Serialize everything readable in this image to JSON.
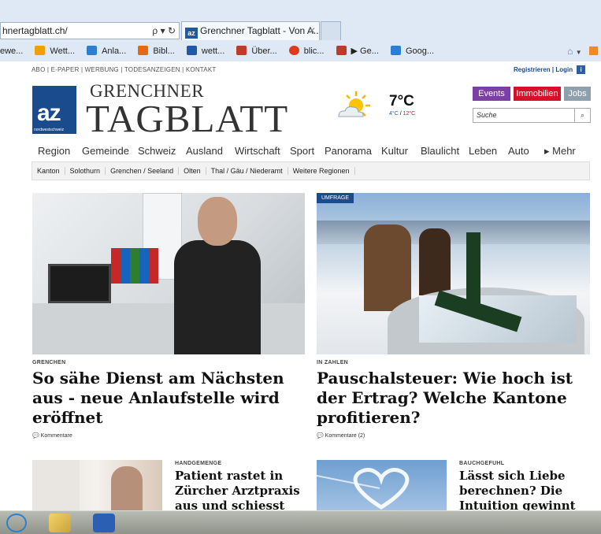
{
  "browser": {
    "address": "hnertagblatt.ch/",
    "address_controls": "ρ ▾ ↻",
    "tab_title": "Grenchner Tagblatt - Von A...",
    "tab_favicon": "az",
    "tab_close": "✕",
    "favorites": [
      "ewe...",
      "Wett...",
      "Anla...",
      "Bibl...",
      "wett...",
      "Über...",
      "blic...",
      "▶ Ge...",
      "Goog..."
    ],
    "favorite_icon_colors": [
      "#ffffff",
      "#f0a000",
      "#2d7fcf",
      "#e86a10",
      "#1e5aa8",
      "#c0392b",
      "#e03a1e",
      "#c0392b",
      "#2a7fd4"
    ]
  },
  "site": {
    "meta_nav": "ABO  |  E-PAPER  |  WERBUNG  |  TODESANZEIGEN  |  KONTAKT",
    "login": "Registrieren | Login",
    "info_icon": "i",
    "logo_text": "az",
    "logo_sub": "nordwestschweiz",
    "title_line1": "GRENCHNER",
    "title_line2": "TAGBLATT",
    "weather": {
      "temp": "7°C",
      "low": "4°C",
      "sep": " / ",
      "high": "12°C"
    },
    "buttons": [
      {
        "label": "Events",
        "color": "#7b3fa6"
      },
      {
        "label": "Immobilien",
        "color": "#d7102a"
      },
      {
        "label": "Jobs",
        "color": "#8fa0ad"
      }
    ],
    "search_placeholder": "Suche",
    "main_nav": [
      "Region",
      "Gemeinde",
      "Schweiz",
      "Ausland",
      "Wirtschaft",
      "Sport",
      "Panorama",
      "Kultur",
      "Blaulicht",
      "Leben",
      "Auto",
      "▸ Mehr"
    ],
    "sub_nav": [
      "Kanton",
      "Solothurn",
      "Grenchen / Seeland",
      "Olten",
      "Thal / Gäu / Niederamt",
      "Weitere Regionen"
    ]
  },
  "articles": [
    {
      "kicker": "GRENCHEN",
      "headline": "So sähe Dienst am Nächsten aus - neue Anlaufstelle wird eröffnet",
      "comments": "Kommentare"
    },
    {
      "badge": "UMFRAGE",
      "kicker": "IN ZAHLEN",
      "headline": "Pauschalsteuer: Wie hoch ist der Ertrag? Welche Kantone profitieren?",
      "comments": "Kommentare (2)"
    },
    {
      "kicker": "HANDGEMENGE",
      "headline": "Patient rastet in Zürcher Arztpraxis aus und schiesst"
    },
    {
      "kicker": "BAUCHGEFUHL",
      "headline": "Lässt sich Liebe berechnen? Die Intuition gewinnt"
    }
  ]
}
